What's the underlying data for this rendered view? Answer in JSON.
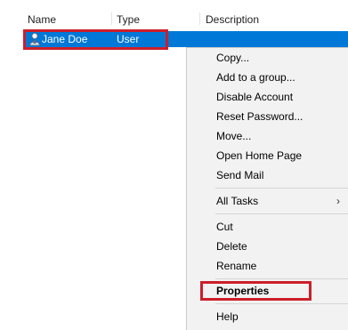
{
  "columns": {
    "name": "Name",
    "type": "Type",
    "description": "Description"
  },
  "row": {
    "name": "Jane Doe",
    "type": "User",
    "icon": "user-icon"
  },
  "menu": {
    "groups": [
      [
        "Copy...",
        "Add to a group...",
        "Disable Account",
        "Reset Password...",
        "Move...",
        "Open Home Page",
        "Send Mail"
      ],
      [
        "All Tasks"
      ],
      [
        "Cut",
        "Delete",
        "Rename"
      ],
      [
        "Properties"
      ],
      [
        "Help"
      ]
    ],
    "submenu_arrow": "›"
  },
  "colors": {
    "selection": "#0078d7",
    "highlight": "#cc1f2a",
    "menu_bg": "#f2f2f2"
  }
}
